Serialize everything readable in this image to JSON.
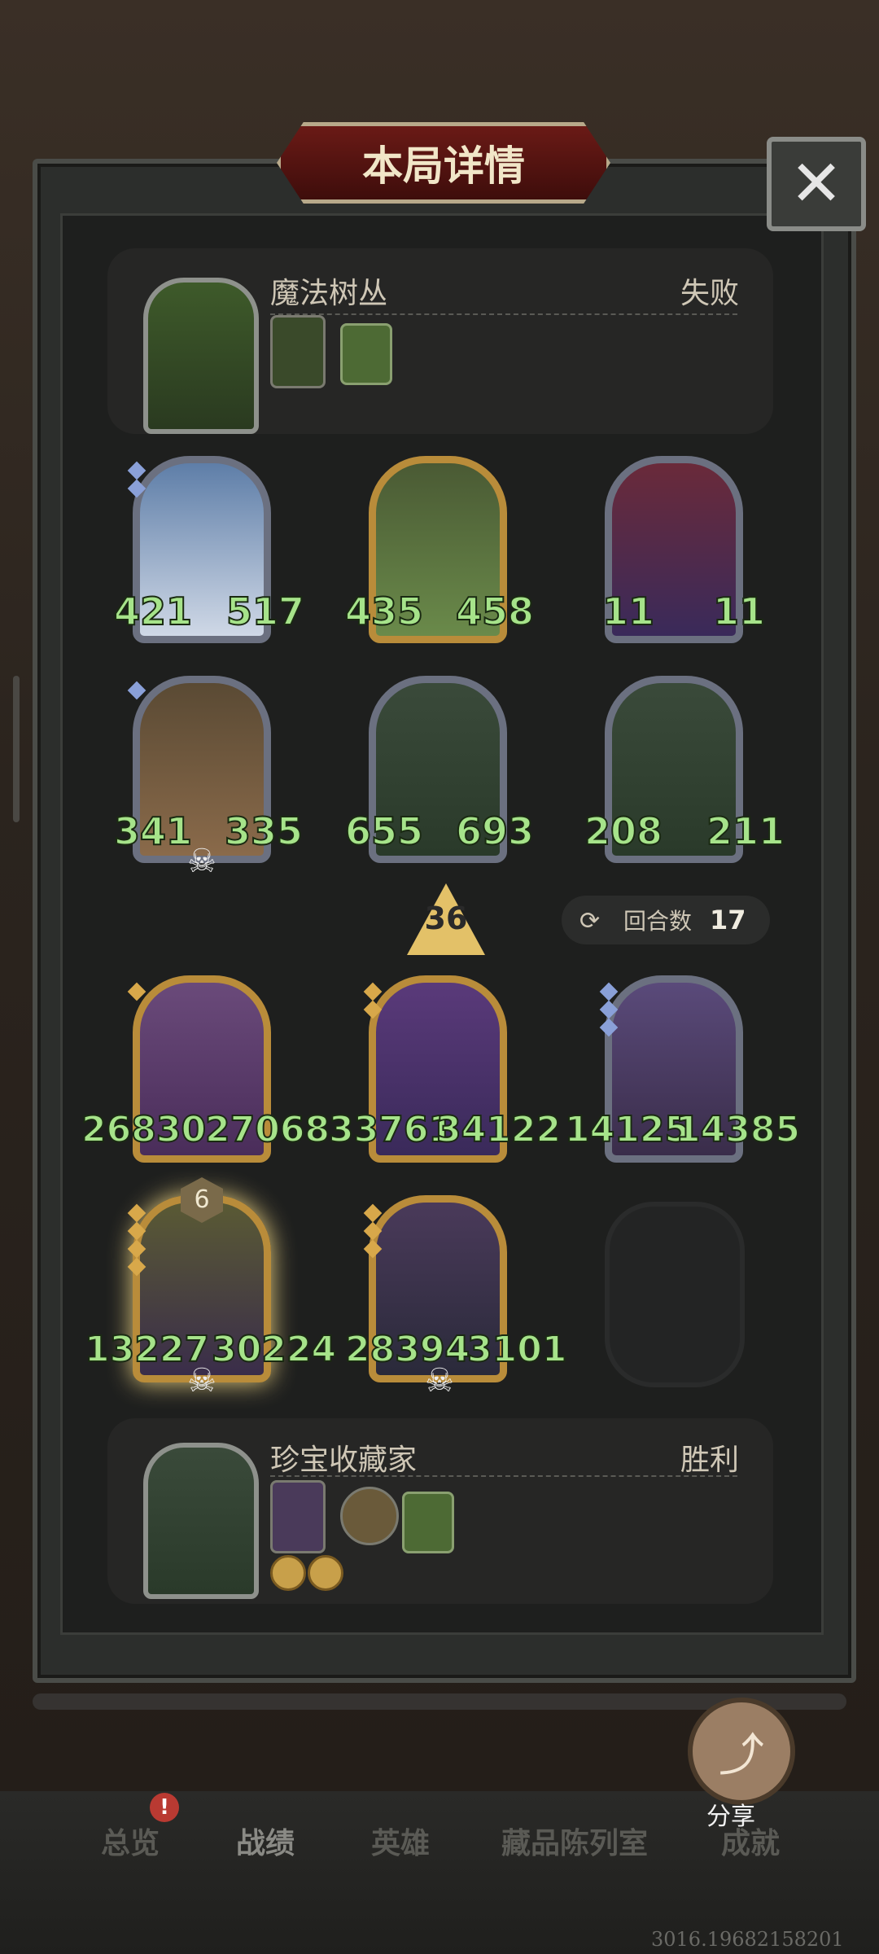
{
  "header": {
    "title": "本局详情",
    "close_label": "✕"
  },
  "top_player": {
    "name": "魔法树丛",
    "result": "失败"
  },
  "bottom_player": {
    "name": "珍宝收藏家",
    "result": "胜利"
  },
  "cards_top": [
    {
      "atk": "421",
      "hp": "517"
    },
    {
      "atk": "435",
      "hp": "458"
    },
    {
      "atk": "11",
      "hp": "11"
    },
    {
      "atk": "341",
      "hp": "335"
    },
    {
      "atk": "655",
      "hp": "693"
    },
    {
      "atk": "208",
      "hp": "211"
    }
  ],
  "cards_bottom": [
    {
      "atk": "26830",
      "hp": "27068"
    },
    {
      "atk": "33761",
      "hp": "34122"
    },
    {
      "atk": "14125",
      "hp": "14385"
    },
    {
      "atk": "13227",
      "hp": "30224",
      "tier": "6"
    },
    {
      "atk": "28394",
      "hp": "3101"
    }
  ],
  "level": "36",
  "round": {
    "label": "回合数",
    "value": "17"
  },
  "share": {
    "label": "分享"
  },
  "nav": {
    "items": [
      "总览",
      "战绩",
      "英雄",
      "藏品陈列室",
      "成就"
    ]
  },
  "notif": "!",
  "footer_code": "3016.19682158201",
  "icons": {
    "close": "close-icon",
    "share": "share-icon",
    "round": "refresh-icon",
    "skull": "skull-icon"
  }
}
